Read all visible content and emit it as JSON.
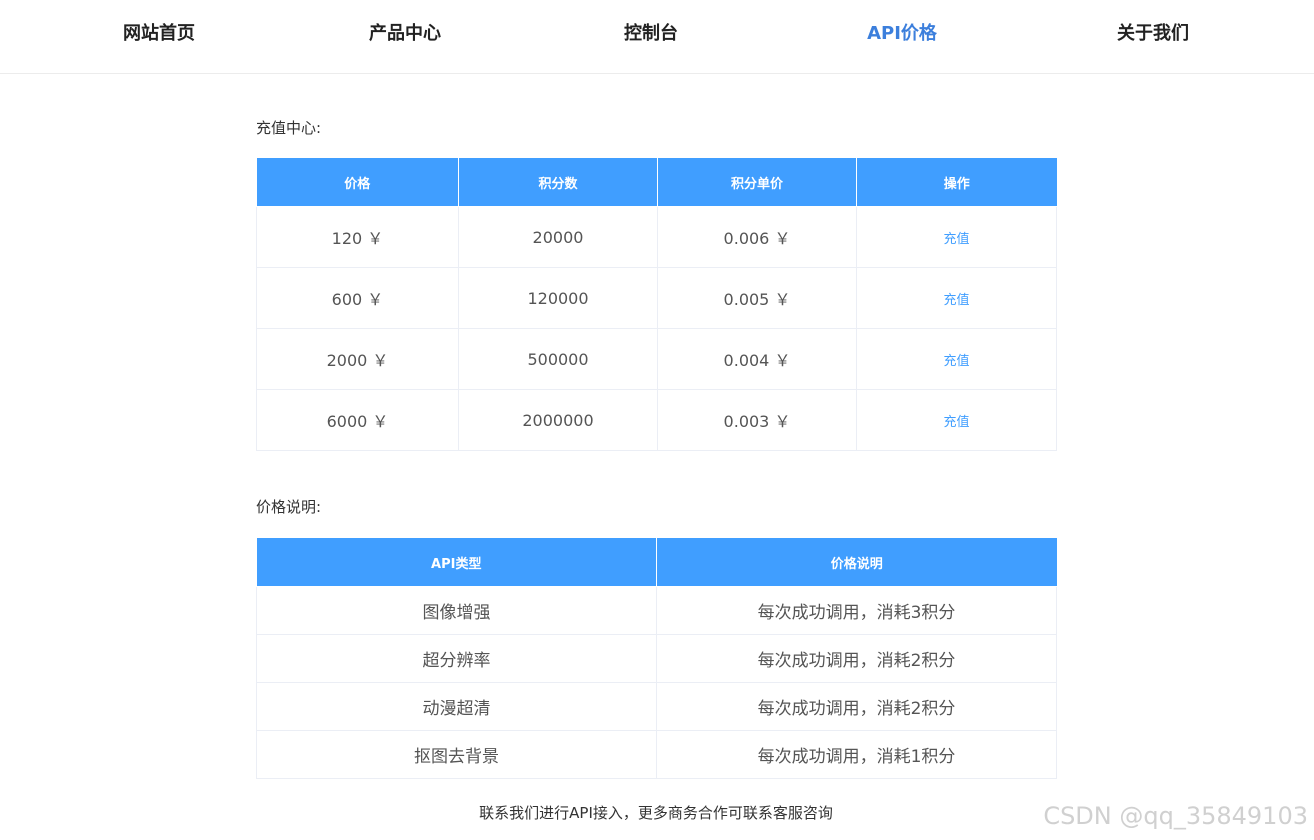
{
  "nav": {
    "items": [
      {
        "label": "网站首页",
        "active": false
      },
      {
        "label": "产品中心",
        "active": false
      },
      {
        "label": "控制台",
        "active": false
      },
      {
        "label": "API价格",
        "active": true
      },
      {
        "label": "关于我们",
        "active": false
      }
    ],
    "accent_color": "#3c7fdc"
  },
  "recharge": {
    "title": "充值中心:",
    "headers": [
      "价格",
      "积分数",
      "积分单价",
      "操作"
    ],
    "rows": [
      {
        "price": "120 ￥",
        "points": "20000",
        "unit_price": "0.006 ￥",
        "action": "充值"
      },
      {
        "price": "600 ￥",
        "points": "120000",
        "unit_price": "0.005 ￥",
        "action": "充值"
      },
      {
        "price": "2000 ￥",
        "points": "500000",
        "unit_price": "0.004 ￥",
        "action": "充值"
      },
      {
        "price": "6000 ￥",
        "points": "2000000",
        "unit_price": "0.003 ￥",
        "action": "充值"
      }
    ],
    "header_color": "#409eff"
  },
  "pricing": {
    "title": "价格说明:",
    "headers": [
      "API类型",
      "价格说明"
    ],
    "rows": [
      {
        "type": "图像增强",
        "desc": "每次成功调用，消耗3积分"
      },
      {
        "type": "超分辨率",
        "desc": "每次成功调用，消耗2积分"
      },
      {
        "type": "动漫超清",
        "desc": "每次成功调用，消耗2积分"
      },
      {
        "type": "抠图去背景",
        "desc": "每次成功调用，消耗1积分"
      }
    ]
  },
  "footer": {
    "note": "联系我们进行API接入，更多商务合作可联系客服咨询"
  },
  "watermark": "CSDN @qq_35849103"
}
